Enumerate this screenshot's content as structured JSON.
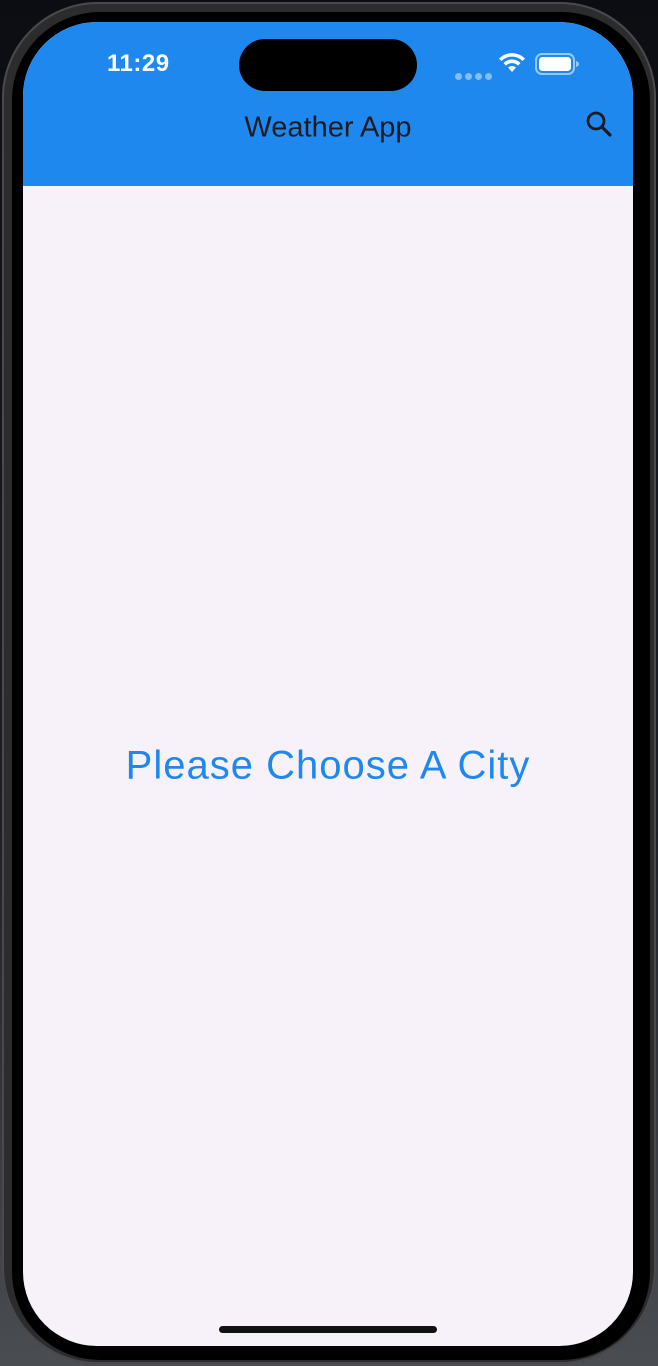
{
  "status_bar": {
    "time": "11:29"
  },
  "app_bar": {
    "title": "Weather App",
    "search_icon": "search-icon",
    "background_color": "#1e88ee"
  },
  "main": {
    "empty_message": "Please Choose A City",
    "message_color": "#1e88ee",
    "background_color": "#f7f2fa"
  }
}
